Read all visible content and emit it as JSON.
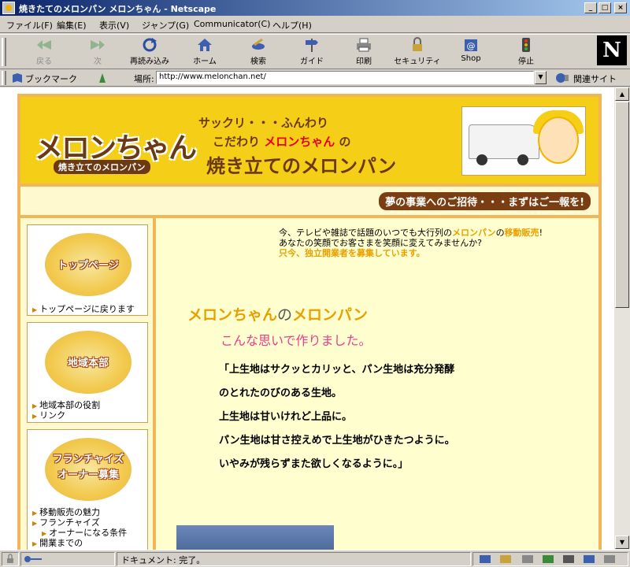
{
  "window": {
    "title": "焼きたてのメロンパン メロンちゃん - Netscape",
    "controls": [
      "_",
      "□",
      "×"
    ]
  },
  "menu": [
    "ファイル(F)",
    "編集(E)",
    "表示(V)",
    "ジャンプ(G)",
    "Communicator(C)",
    "ヘルプ(H)"
  ],
  "toolbar": {
    "back": "戻る",
    "forward": "次",
    "reload": "再読み込み",
    "home": "ホーム",
    "search": "検索",
    "guide": "ガイド",
    "print": "印刷",
    "security": "セキュリティ",
    "shop": "Shop",
    "stop": "停止"
  },
  "location": {
    "bookmarks": "ブックマーク",
    "label": "場所:",
    "url": "http://www.melonchan.net/",
    "related": "関連サイト"
  },
  "banner": {
    "logo": "メロンちゃん",
    "logo_sub": "焼き立てのメロンパン",
    "line1": "サックリ・・・ふんわり",
    "line2_pre": "こだわり",
    "line2_brand": "メロンちゃん",
    "line2_post": "の",
    "line3": "焼き立てのメロンパン",
    "slogan": "夢の事業へのご招待・・・まずはご一報を!"
  },
  "sidebar": {
    "top": {
      "picture_text": "トップページ",
      "link": "トップページに戻ります"
    },
    "regional": {
      "picture_text": "地域本部",
      "links": [
        "地域本部の役割",
        "リンク"
      ]
    },
    "franchise": {
      "picture_text_1": "フランチャイズ",
      "picture_text_2": "オーナー募集",
      "links": [
        "移動販売の魅力",
        "フランチャイズ",
        "オーナーになる条件",
        "開業までの"
      ]
    }
  },
  "main": {
    "intro_1a": "今、テレビや雑誌で話題のいつでも大行列の",
    "intro_1b": "メロンパン",
    "intro_1c": "の",
    "intro_1d": "移動販売",
    "intro_1e": "!",
    "intro_2": "あなたの笑顔でお客さまを笑顔に変えてみませんか?",
    "intro_3": "只今、独立開業者を募集しています。",
    "heading_a": "メロンちゃん",
    "heading_no": "の",
    "heading_b": "メロンパン",
    "subheading": "こんな思いで作りました。",
    "quote": [
      "「上生地はサクッとカリッと、パン生地は充分発酵",
      "のとれたのびのある生地。",
      "上生地は甘いけれど上品に。",
      "パン生地は甘さ控えめで上生地がひきたつように。",
      "いやみが残らずまた欲しくなるように。」"
    ]
  },
  "status": {
    "message": "ドキュメント: 完了。"
  },
  "colors": {
    "title_bar": "#0a246a",
    "page_frame": "#f0b65a",
    "banner_bg": "#f5ce17",
    "brand_red": "#e8001c",
    "accent_orange": "#e8a000",
    "accent_pink": "#e83c8c",
    "content_bg": "#fffecf"
  }
}
